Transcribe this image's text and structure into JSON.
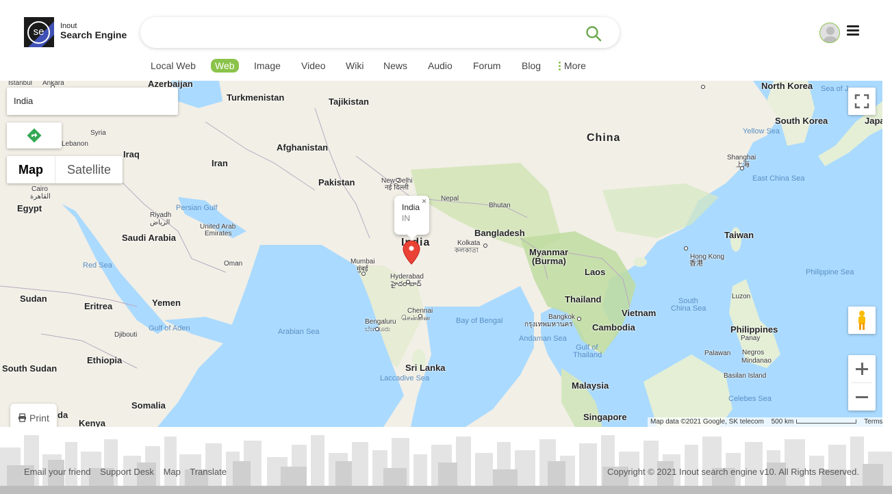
{
  "logo": {
    "mark": "se",
    "small": "Inout",
    "big": "Search Engine"
  },
  "search": {
    "value": "",
    "placeholder": "",
    "icon": "search-icon"
  },
  "nav": {
    "items": [
      {
        "label": "Local Web",
        "active": false
      },
      {
        "label": "Web",
        "active": true
      },
      {
        "label": "Image",
        "active": false
      },
      {
        "label": "Video",
        "active": false
      },
      {
        "label": "Wiki",
        "active": false
      },
      {
        "label": "News",
        "active": false
      },
      {
        "label": "Audio",
        "active": false
      },
      {
        "label": "Forum",
        "active": false
      },
      {
        "label": "Blog",
        "active": false
      }
    ],
    "more": "More"
  },
  "colors": {
    "accent": "#8bc34a",
    "marker": "#ea4335",
    "water": "#aadaff",
    "land": "#f2efe6"
  },
  "map": {
    "place_input": "India",
    "map_type": {
      "map": "Map",
      "satellite": "Satellite"
    },
    "print": "Print",
    "info": {
      "title": "India",
      "code": "IN",
      "close": "×"
    },
    "labels": {
      "istanbul": "Istanbul",
      "ankara": "Ankara",
      "azerbaijan": "Azerbaijan",
      "turkmenistan": "Turkmenistan",
      "tajikistan": "Tajikistan",
      "syria": "Syria",
      "lebanon": "Lebanon",
      "iraq": "Iraq",
      "afghanistan": "Afghanistan",
      "iran": "Iran",
      "pakistan": "Pakistan",
      "new_delhi": "New Delhi",
      "new_delhi_local": "नई दिल्ली",
      "nepal": "Nepal",
      "bhutan": "Bhutan",
      "cairo": "Cairo",
      "cairo_local": "القاهرة",
      "egypt": "Egypt",
      "riyadh": "Riyadh",
      "riyadh_local": "الرياض",
      "persian_gulf": "Persian Gulf",
      "uae": "United Arab",
      "uae2": "Emirates",
      "saudi": "Saudi Arabia",
      "oman": "Oman",
      "india": "India",
      "bangladesh": "Bangladesh",
      "kolkata": "Kolkata",
      "kolkata_local": "কলকাতা",
      "mumbai": "Mumbai",
      "mumbai_local": "मुंबई",
      "hyderabad": "Hyderabad",
      "hyderabad_local": "హైదరాబాద్",
      "myanmar": "Myanmar",
      "burma": "(Burma)",
      "red_sea": "Red Sea",
      "sudan": "Sudan",
      "eritrea": "Eritrea",
      "yemen": "Yemen",
      "gulf_aden": "Gulf of Aden",
      "djibouti": "Djibouti",
      "arabian_sea": "Arabian Sea",
      "chennai": "Chennai",
      "chennai_local": "சென்னை",
      "bengaluru": "Bengaluru",
      "bengaluru_local": "ಬೆಂಗಳೂರು",
      "bay_bengal": "Bay of Bengal",
      "ethiopia": "Ethiopia",
      "south_sudan": "South Sudan",
      "sri_lanka": "Sri Lanka",
      "laccadive": "Laccadive Sea",
      "somalia": "Somalia",
      "kenya": "Kenya",
      "uganda": "da",
      "china": "China",
      "north_korea": "North Korea",
      "sea_of_j": "Sea of J",
      "south_korea": "South Korea",
      "japan": "Japa",
      "yellow_sea": "Yellow Sea",
      "shanghai": "Shanghai",
      "shanghai_local": "上海",
      "east_china_sea": "East China Sea",
      "taiwan": "Taiwan",
      "laos": "Laos",
      "hong_kong": "Hong Kong",
      "hong_kong_local": "香港",
      "thailand": "Thailand",
      "vietnam": "Vietnam",
      "bangkok": "Bangkok",
      "bangkok_local": "กรุงเทพมหานคร",
      "cambodia": "Cambodia",
      "south_china_sea": "South",
      "south_china_sea2": "China Sea",
      "andaman": "Andaman Sea",
      "gulf_thailand": "Gulf of",
      "gulf_thailand2": "Thailand",
      "luzon": "Luzon",
      "philippine_sea": "Philippine Sea",
      "philippines": "Philippines",
      "panay": "Panay",
      "negros": "Negros",
      "mindanao": "Mindanao",
      "palawan": "Palawan",
      "basilan": "Basilan Island",
      "malaysia": "Malaysia",
      "celebes": "Celebes Sea",
      "singapore": "Singapore"
    },
    "attribution": {
      "data": "Map data ©2021 Google, SK telecom",
      "scale": "500 km",
      "terms": "Terms of Use"
    }
  },
  "footer": {
    "links": [
      "Email your friend",
      "Support Desk",
      "Map",
      "Translate"
    ],
    "copyright": "Copyright © 2021 Inout search engine v10. All Rights Reserved."
  }
}
